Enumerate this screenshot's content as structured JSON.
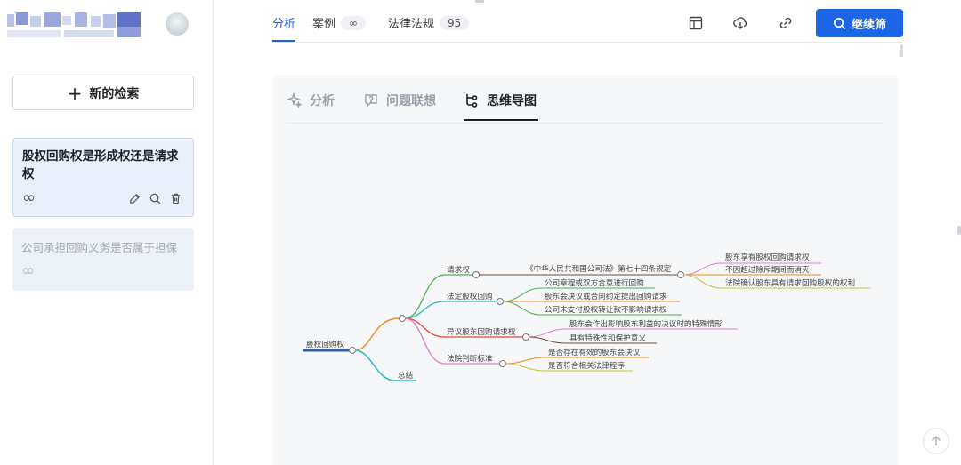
{
  "sidebar": {
    "new_search_label": "新的检索",
    "history": [
      {
        "title": "股权回购权是形成权还是请求权",
        "count_symbol": "∞"
      },
      {
        "title": "公司承担回购义务是否属于担保",
        "count_symbol": "∞"
      }
    ]
  },
  "topbar": {
    "tabs": [
      {
        "label": "分析"
      },
      {
        "label": "案例",
        "badge": "∞"
      },
      {
        "label": "法律法规",
        "badge": "95"
      }
    ],
    "continue_label": "继续筛"
  },
  "panel": {
    "tabs": [
      {
        "label": "分析",
        "icon": "sparkle-icon"
      },
      {
        "label": "问题联想",
        "icon": "question-bubble-icon"
      },
      {
        "label": "思维导图",
        "icon": "mindmap-icon"
      }
    ]
  },
  "mindmap": {
    "root": "股权回购权",
    "branches": [
      {
        "label": "请求权",
        "children": [
          "《中华人民共和国公司法》第七十四条规定"
        ],
        "grandchildren": [
          "股东享有股权回购请求权",
          "不因超过除斥期间而消灭",
          "法院确认股东具有请求回购股权的权利"
        ]
      },
      {
        "label": "法定股权回购",
        "children": [
          "公司章程或双方合意进行回购",
          "股东会决议或合同约定提出回购请求",
          "公司未支付股权转让款不影响请求权"
        ]
      },
      {
        "label": "异议股东回购请求权",
        "children": [
          "股东会作出影响股东利益的决议时的特殊情形",
          "具有特殊性和保护意义"
        ]
      },
      {
        "label": "法院判断标准",
        "children": [
          "是否存在有效的股东会决议",
          "是否符合相关法律程序"
        ]
      },
      {
        "label": "总结",
        "children": []
      }
    ]
  },
  "colors": {
    "accent": "#1a66e6",
    "branch_green": "#4caf50",
    "branch_teal": "#26b5c6",
    "branch_red": "#e04a3f",
    "branch_pink": "#e27bd0",
    "branch_orange": "#f28a1c"
  }
}
